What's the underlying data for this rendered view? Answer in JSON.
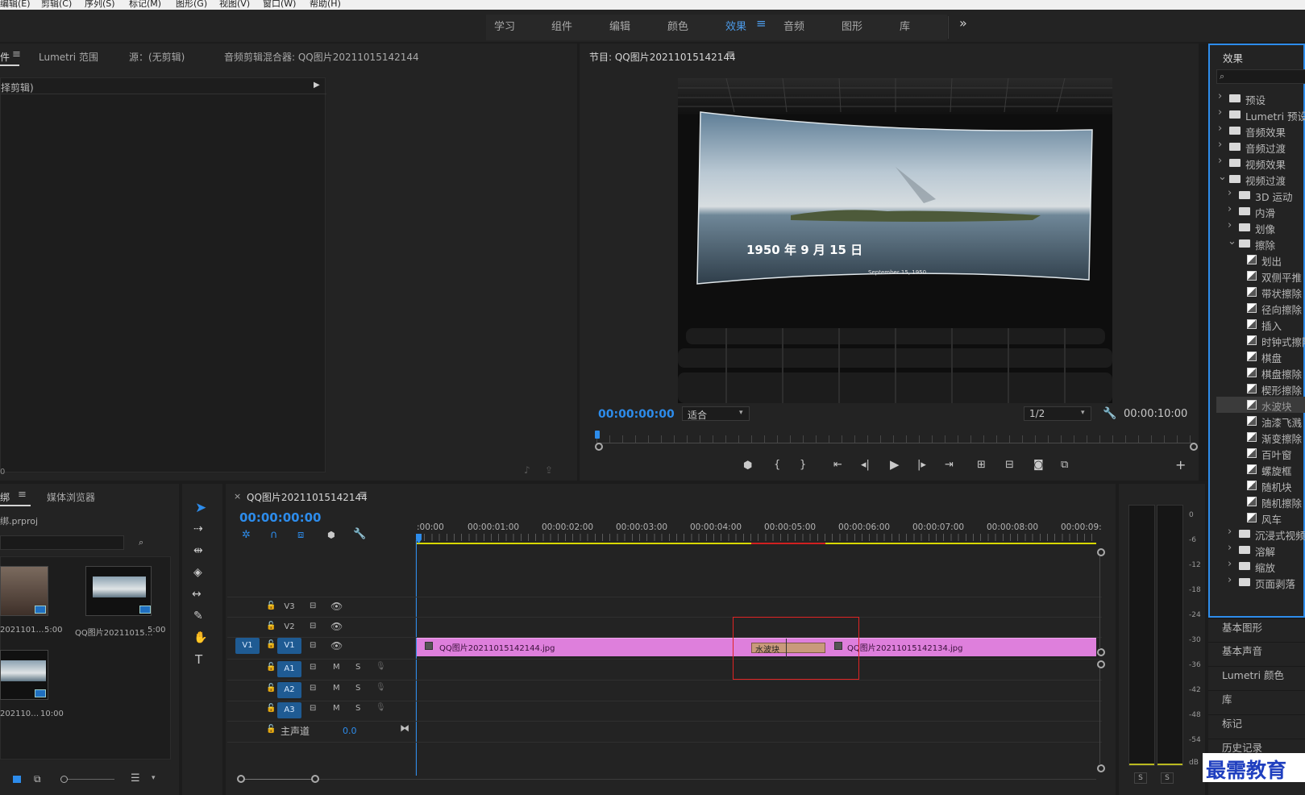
{
  "menubar": {
    "items": [
      "编辑(E)",
      "剪辑(C)",
      "序列(S)",
      "标记(M)",
      "图形(G)",
      "视图(V)",
      "窗口(W)",
      "帮助(H)"
    ]
  },
  "workspaces": {
    "items": [
      "学习",
      "组件",
      "编辑",
      "颜色",
      "效果",
      "音频",
      "图形",
      "库"
    ],
    "active": "效果",
    "more": "»"
  },
  "source_panel": {
    "tabs": [
      "件",
      "Lumetri 范围",
      "源：(无剪辑)",
      "音频剪辑混合器: QQ图片20211015142144"
    ],
    "dropdown": "择剪辑)",
    "footer_left": "0"
  },
  "program_monitor": {
    "title": "节目: QQ图片20211015142144",
    "timecode_current": "00:00:00:00",
    "fit": "适合",
    "resolution": "1/2",
    "timecode_end": "00:00:10:00",
    "frame_text_main": "1950 年 9 月 15 日",
    "frame_text_sub": "September 15, 1950"
  },
  "project_panel": {
    "tabs": [
      "绑",
      "媒体浏览器"
    ],
    "project_name": "绑.prproj",
    "items": [
      {
        "name": "2021101…",
        "duration": "5:00"
      },
      {
        "name": "QQ图片20211015…",
        "duration": "5:00"
      },
      {
        "name": "202110…",
        "duration": "10:00"
      }
    ]
  },
  "timeline": {
    "sequence_name": "QQ图片20211015142144",
    "timecode": "00:00:00:00",
    "ruler": [
      ":00:00",
      "00:00:01:00",
      "00:00:02:00",
      "00:00:03:00",
      "00:00:04:00",
      "00:00:05:00",
      "00:00:06:00",
      "00:00:07:00",
      "00:00:08:00",
      "00:00:09:"
    ],
    "video_tracks": [
      "V3",
      "V2",
      "V1"
    ],
    "audio_tracks": [
      "A1",
      "A2",
      "A3"
    ],
    "master_label": "主声道",
    "master_value": "0.0",
    "clip1": "QQ图片20211015142144.jpg",
    "clip2": "QQ图片20211015142134.jpg",
    "transition": "水波块",
    "mute": "M",
    "solo": "S"
  },
  "audio_meter": {
    "scale": [
      "0",
      "-6",
      "-12",
      "-18",
      "-24",
      "-30",
      "-36",
      "-42",
      "-48",
      "-54",
      "dB"
    ],
    "solo": [
      "S",
      "S"
    ]
  },
  "effects_panel": {
    "title": "效果",
    "tree": [
      {
        "label": "预设",
        "level": 0,
        "kind": "bin",
        "open": false
      },
      {
        "label": "Lumetri 预设",
        "level": 0,
        "kind": "bin",
        "open": false
      },
      {
        "label": "音频效果",
        "level": 0,
        "kind": "folder",
        "open": false
      },
      {
        "label": "音频过渡",
        "level": 0,
        "kind": "folder",
        "open": false
      },
      {
        "label": "视频效果",
        "level": 0,
        "kind": "folder",
        "open": false
      },
      {
        "label": "视频过渡",
        "level": 0,
        "kind": "folder",
        "open": true
      },
      {
        "label": "3D 运动",
        "level": 1,
        "kind": "folder",
        "open": false
      },
      {
        "label": "内滑",
        "level": 1,
        "kind": "folder",
        "open": false
      },
      {
        "label": "划像",
        "level": 1,
        "kind": "folder",
        "open": false
      },
      {
        "label": "擦除",
        "level": 1,
        "kind": "folder",
        "open": true
      },
      {
        "label": "划出",
        "level": 2,
        "kind": "fx"
      },
      {
        "label": "双侧平推",
        "level": 2,
        "kind": "fx"
      },
      {
        "label": "带状擦除",
        "level": 2,
        "kind": "fx"
      },
      {
        "label": "径向擦除",
        "level": 2,
        "kind": "fx"
      },
      {
        "label": "插入",
        "level": 2,
        "kind": "fx"
      },
      {
        "label": "时钟式擦除",
        "level": 2,
        "kind": "fx"
      },
      {
        "label": "棋盘",
        "level": 2,
        "kind": "fx"
      },
      {
        "label": "棋盘擦除",
        "level": 2,
        "kind": "fx"
      },
      {
        "label": "楔形擦除",
        "level": 2,
        "kind": "fx"
      },
      {
        "label": "水波块",
        "level": 2,
        "kind": "fx",
        "selected": true
      },
      {
        "label": "油漆飞溅",
        "level": 2,
        "kind": "fx"
      },
      {
        "label": "渐变擦除",
        "level": 2,
        "kind": "fx"
      },
      {
        "label": "百叶窗",
        "level": 2,
        "kind": "fx"
      },
      {
        "label": "螺旋框",
        "level": 2,
        "kind": "fx"
      },
      {
        "label": "随机块",
        "level": 2,
        "kind": "fx"
      },
      {
        "label": "随机擦除",
        "level": 2,
        "kind": "fx"
      },
      {
        "label": "风车",
        "level": 2,
        "kind": "fx"
      },
      {
        "label": "沉浸式视频",
        "level": 1,
        "kind": "folder",
        "open": false
      },
      {
        "label": "溶解",
        "level": 1,
        "kind": "folder",
        "open": false
      },
      {
        "label": "缩放",
        "level": 1,
        "kind": "folder",
        "open": false
      },
      {
        "label": "页面剥落",
        "level": 1,
        "kind": "folder",
        "open": false
      }
    ],
    "side_panels": [
      "基本图形",
      "基本声音",
      "Lumetri 颜色",
      "库",
      "标记",
      "历史记录"
    ]
  },
  "watermark": "最需教育"
}
